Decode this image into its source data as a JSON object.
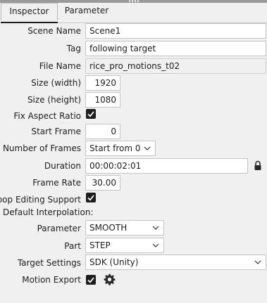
{
  "tabs": [
    {
      "label": "Inspector",
      "active": true
    },
    {
      "label": "Parameter",
      "active": false
    }
  ],
  "fields": {
    "scene_name": {
      "label": "Scene Name",
      "value": "Scene1"
    },
    "tag": {
      "label": "Tag",
      "value": "following target"
    },
    "file_name": {
      "label": "File Name",
      "value": "rice_pro_motions_t02"
    },
    "size_width": {
      "label": "Size (width)",
      "value": "1920"
    },
    "size_height": {
      "label": "Size (height)",
      "value": "1080"
    },
    "fix_aspect": {
      "label": "Fix Aspect Ratio",
      "checked": true
    },
    "start_frame": {
      "label": "Start Frame",
      "value": "0"
    },
    "num_frames": {
      "label": "Number of Frames",
      "value": "Start from 0"
    },
    "duration": {
      "label": "Duration",
      "value": "00:00:02:01"
    },
    "frame_rate": {
      "label": "Frame Rate",
      "value": "30.00"
    },
    "loop_editing": {
      "label": "Loop Editing Support",
      "checked": true
    },
    "default_interp": {
      "label": "Default Interpolation:"
    },
    "parameter": {
      "label": "Parameter",
      "value": "SMOOTH"
    },
    "part": {
      "label": "Part",
      "value": "STEP"
    },
    "target_settings": {
      "label": "Target Settings",
      "value": "SDK (Unity)"
    },
    "motion_export": {
      "label": "Motion Export",
      "checked": true
    }
  },
  "icons": {
    "duration_lock": "lock-icon",
    "export_settings": "gear-icon",
    "dropdown": "chevron-down-icon"
  },
  "colors": {
    "background": "#f0f0f0",
    "checkbox_fill": "#1e1e1e",
    "field_border": "#c4c4c4"
  }
}
